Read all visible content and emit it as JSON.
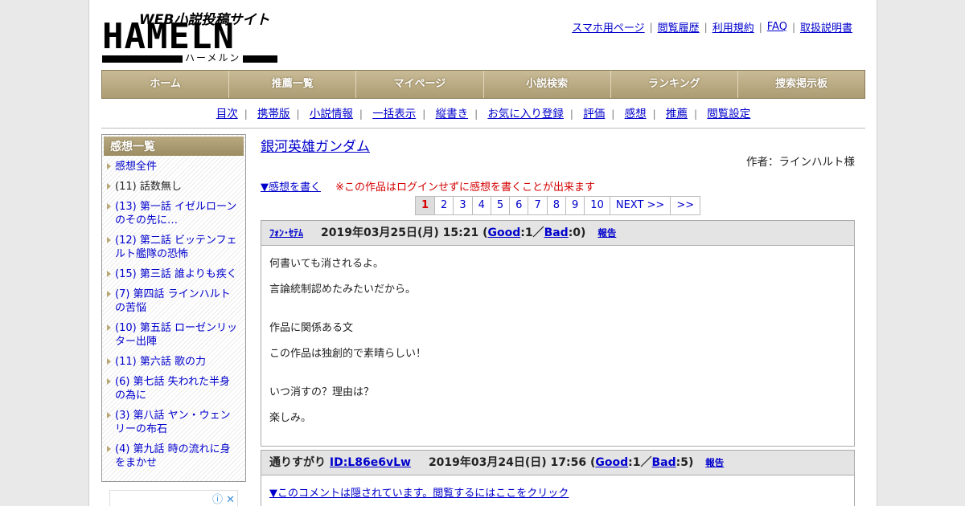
{
  "logo": {
    "web": "WEB小説投稿サイト",
    "main": "HAMELN",
    "kana": "ハーメルン"
  },
  "toplinks": [
    "スマホ用ページ",
    "閲覧履歴",
    "利用規約",
    "FAQ",
    "取扱説明書"
  ],
  "mainnav": [
    "ホーム",
    "推薦一覧",
    "マイページ",
    "小説検索",
    "ランキング",
    "捜索掲示板"
  ],
  "subnav": [
    "目次",
    "携帯版",
    "小説情報",
    "一括表示",
    "縦書き",
    "お気に入り登録",
    "評価",
    "感想",
    "推薦",
    "閲覧設定"
  ],
  "sidebar": {
    "heading": "感想一覧",
    "items": [
      "感想全件",
      "(11) 話数無し",
      "(13) 第一話 イゼルローンのその先に…",
      "(12) 第二話 ビッテンフェルト艦隊の恐怖",
      "(15) 第三話 誰よりも疾く",
      "(7) 第四話 ラインハルトの苦悩",
      "(10) 第五話 ローゼンリッター出陣",
      "(11) 第六話 歌の力",
      "(6) 第七話 失われた半身の為に",
      "(3) 第八話 ヤン・ウェンリーの布石",
      "(4) 第九話 時の流れに身をまかせ"
    ]
  },
  "content": {
    "title": "銀河英雄ガンダム",
    "author": "作者：ラインハルト様",
    "write_link": "▼感想を書く",
    "warning": "※この作品はログインせずに感想を書くことが出来ます",
    "pager": [
      "1",
      "2",
      "3",
      "4",
      "5",
      "6",
      "7",
      "8",
      "9",
      "10",
      "NEXT >>",
      ">>"
    ],
    "reviews": [
      {
        "name": "ﾌｫﾝ･ｾﾃﾑ",
        "date": "2019年03月25日(月) 15:21",
        "good_label": "Good",
        "good": ":1／",
        "bad_label": "Bad",
        "bad": ":0)",
        "report": "報告",
        "lines": [
          "何書いても消されるよ。",
          "言論統制認めたみたいだから。",
          "作品に関係ある文",
          "この作品は独創的で素晴らしい！",
          "いつ消すの？理由は？",
          "楽しみ。"
        ]
      },
      {
        "name": "通りすがり",
        "id": "ID:L86e6vLw",
        "date": "2019年03月24日(日) 17:56",
        "good_label": "Good",
        "good": ":1／",
        "bad_label": "Bad",
        "bad": ":5)",
        "report": "報告",
        "hidden_notice": "▼このコメントは隠されています。閲覧するにはここをクリック"
      }
    ]
  },
  "colors": {
    "nav_bg": "#ac9c72",
    "link": "#0000cc",
    "warning": "#d40000"
  }
}
